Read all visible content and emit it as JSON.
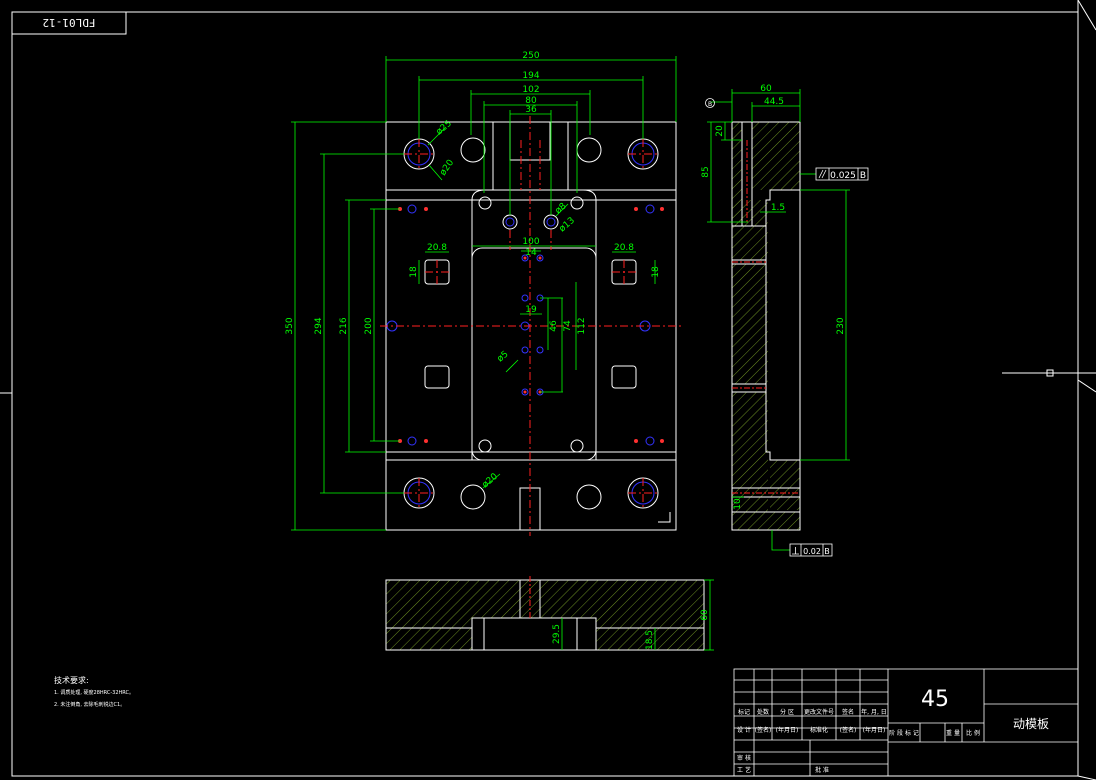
{
  "drawing_number": "FDL01-12",
  "dimensions": {
    "w250": "250",
    "w194": "194",
    "w102": "102",
    "w80": "80",
    "w36": "36",
    "h350": "350",
    "h294": "294",
    "h216": "216",
    "h200": "200",
    "d25": "ø25",
    "d20a": "ø20",
    "d8": "ø8",
    "d13": "ø13",
    "d20b": "ø20",
    "d5": "ø5",
    "w100": "100",
    "w14": "14",
    "w19": "19",
    "v46": "46",
    "v74": "74",
    "v112": "112",
    "c20_8a": "20.8",
    "c20_8b": "20.8",
    "c18a": "18",
    "c18b": "18",
    "s60": "60",
    "s44_5": "44.5",
    "s20": "20",
    "s85": "85",
    "s230": "230",
    "s1_5": "1.5",
    "s10": "10",
    "b60": "60",
    "b29_5": "29.5",
    "b18_5": "18.5"
  },
  "tolerances": {
    "parallel_value": "0.025",
    "parallel_datum": "B",
    "perp_value": "0.02",
    "perp_datum": "B",
    "datum_marker": "B"
  },
  "notes": {
    "heading": "技术要求:",
    "line1": "1. 调质处理, 硬度28HRC-32HRC。",
    "line2": "2. 未注倒角, 去除毛刺锐边C1。"
  },
  "title_block": {
    "material": "45",
    "part_name": "动模板",
    "row_labels": [
      "标记",
      "处数",
      "分 区",
      "更改文件号",
      "签名",
      "年, 月, 日"
    ],
    "design_row": [
      "设 计",
      "(签名)",
      "(年月日)",
      "标准化",
      "(签名)",
      "(年月日)"
    ],
    "stage_labels": [
      "阶 段 标 记",
      "重 量",
      "比 例"
    ],
    "review_label": "审 核",
    "process_label": "工 艺",
    "approve_label": "批 准"
  },
  "colors": {
    "background": "#000000",
    "outline": "#ffffff",
    "dimension": "#00ff00",
    "centerline": "#ff0000",
    "hidden": "#0000ff",
    "hatch": "#6b8e23"
  }
}
